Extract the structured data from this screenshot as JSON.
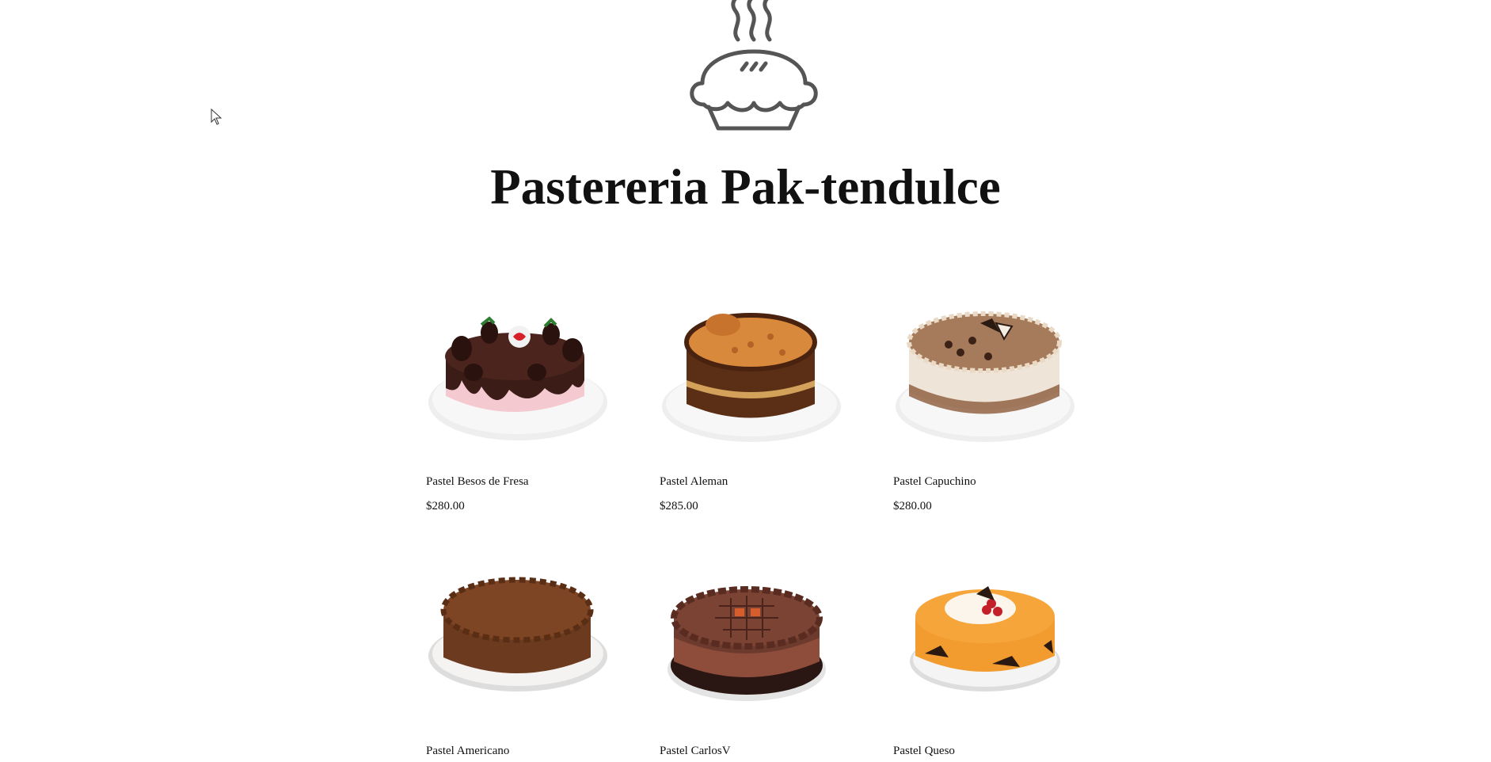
{
  "header": {
    "logo_icon": "pie-icon",
    "title": "Pastereria Pak-tendulce"
  },
  "products": [
    {
      "name": "Pastel Besos de Fresa",
      "price": "$280.00",
      "image_icon": "strawberry-chocolate-cake-image"
    },
    {
      "name": "Pastel Aleman",
      "price": "$285.00",
      "image_icon": "german-cake-image"
    },
    {
      "name": "Pastel Capuchino",
      "price": "$280.00",
      "image_icon": "cappuccino-cake-image"
    },
    {
      "name": "Pastel Americano",
      "price": "",
      "image_icon": "chocolate-cake-image"
    },
    {
      "name": "Pastel CarlosV",
      "price": "",
      "image_icon": "carlosv-cake-image"
    },
    {
      "name": "Pastel Queso",
      "price": "",
      "image_icon": "cheesecake-image"
    }
  ],
  "colors": {
    "logo_stroke": "#555555",
    "text": "#111111",
    "background": "#ffffff"
  }
}
